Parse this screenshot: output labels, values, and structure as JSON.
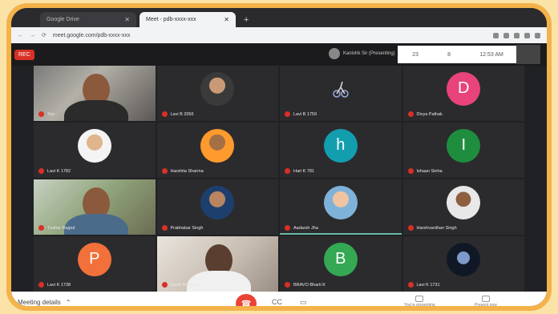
{
  "browser": {
    "tabs": [
      {
        "title": "Google Drive",
        "active": false
      },
      {
        "title": "Meet - pdb-xxxx-xxx",
        "active": true
      }
    ],
    "url": "meet.google.com/pdb-xxxx-xxx"
  },
  "meeting": {
    "rec_label": "REC",
    "presenter": "Kanishk Sir (Presenting)",
    "top_right": [
      "23",
      "8",
      "12:53 AM"
    ],
    "bottom_label": "Meeting details",
    "controls": {
      "hangup_icon": "phone-icon",
      "cc_label": "CC",
      "present_label": "▭",
      "people_label": "You're presenting",
      "present_now_label": "Present now"
    }
  },
  "participants": [
    {
      "name": "You",
      "type": "video1"
    },
    {
      "name": "Lavi B 2056",
      "type": "photo"
    },
    {
      "name": "Lavi B 1759",
      "type": "bicycle"
    },
    {
      "name": "Divya Pathak",
      "letter": "D",
      "color": "#e8437a"
    },
    {
      "name": "Lavi K 1782",
      "type": "photo2"
    },
    {
      "name": "Harshita Sharma",
      "type": "photo5"
    },
    {
      "name": "Hari K 781",
      "letter": "h",
      "color": "#129eaf"
    },
    {
      "name": "Ishaan Sinha",
      "letter": "I",
      "color": "#1e8e3e"
    },
    {
      "name": "Tushar Rajput",
      "type": "video2"
    },
    {
      "name": "Prabhakar Singh",
      "type": "photo3"
    },
    {
      "name": "Aadarsh Jha",
      "type": "photo6"
    },
    {
      "name": "Harshvardhan Singh",
      "type": "photo4"
    },
    {
      "name": "Lavi K 1738",
      "letter": "P",
      "color": "#f2703a"
    },
    {
      "name": "Swati Bhardwaj",
      "type": "video3"
    },
    {
      "name": "BRAVO Bharti K",
      "letter": "B",
      "color": "#34a853"
    },
    {
      "name": "Lavi K 1731",
      "type": "photo7"
    }
  ]
}
